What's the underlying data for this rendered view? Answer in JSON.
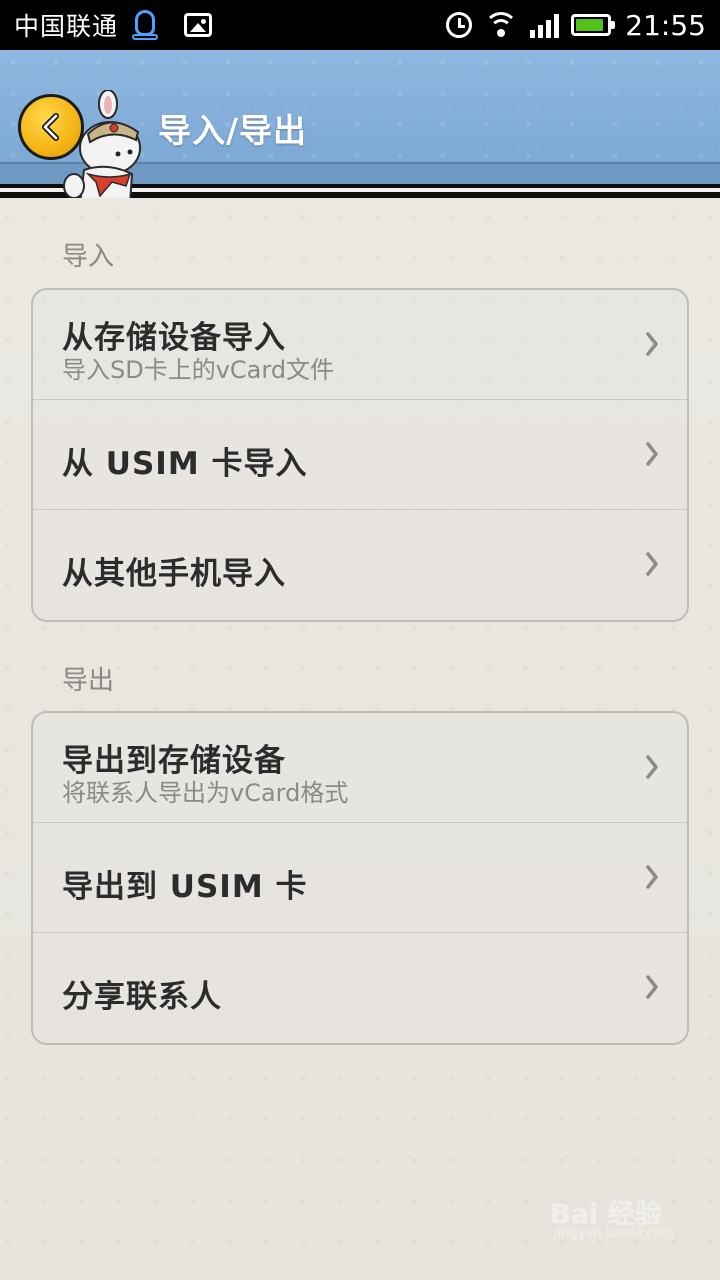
{
  "status_bar": {
    "carrier": "中国联通",
    "time": "21:55",
    "battery_level": 0.9,
    "battery_color": "#52c21a",
    "qq_color": "#4aa3ff"
  },
  "header": {
    "title": "导入/导出",
    "back_icon": "chevron-left-icon",
    "mascot": "mascot-icon"
  },
  "sections": [
    {
      "label": "导入",
      "items": [
        {
          "title": "从存储设备导入",
          "subtitle": "导入SD卡上的vCard文件"
        },
        {
          "title": "从 USIM 卡导入"
        },
        {
          "title": "从其他手机导入"
        }
      ]
    },
    {
      "label": "导出",
      "items": [
        {
          "title": "导出到存储设备",
          "subtitle": "将联系人导出为vCard格式"
        },
        {
          "title": "导出到 USIM 卡"
        },
        {
          "title": "分享联系人"
        }
      ]
    }
  ],
  "watermark": {
    "brand": "Bai 经验",
    "url": "jingyan.baidu.com"
  },
  "colors": {
    "header_blue": "#8fb8e0",
    "background": "#e9e6e0",
    "title_text": "#2c2c2c",
    "sub_text": "#8c8a86"
  }
}
